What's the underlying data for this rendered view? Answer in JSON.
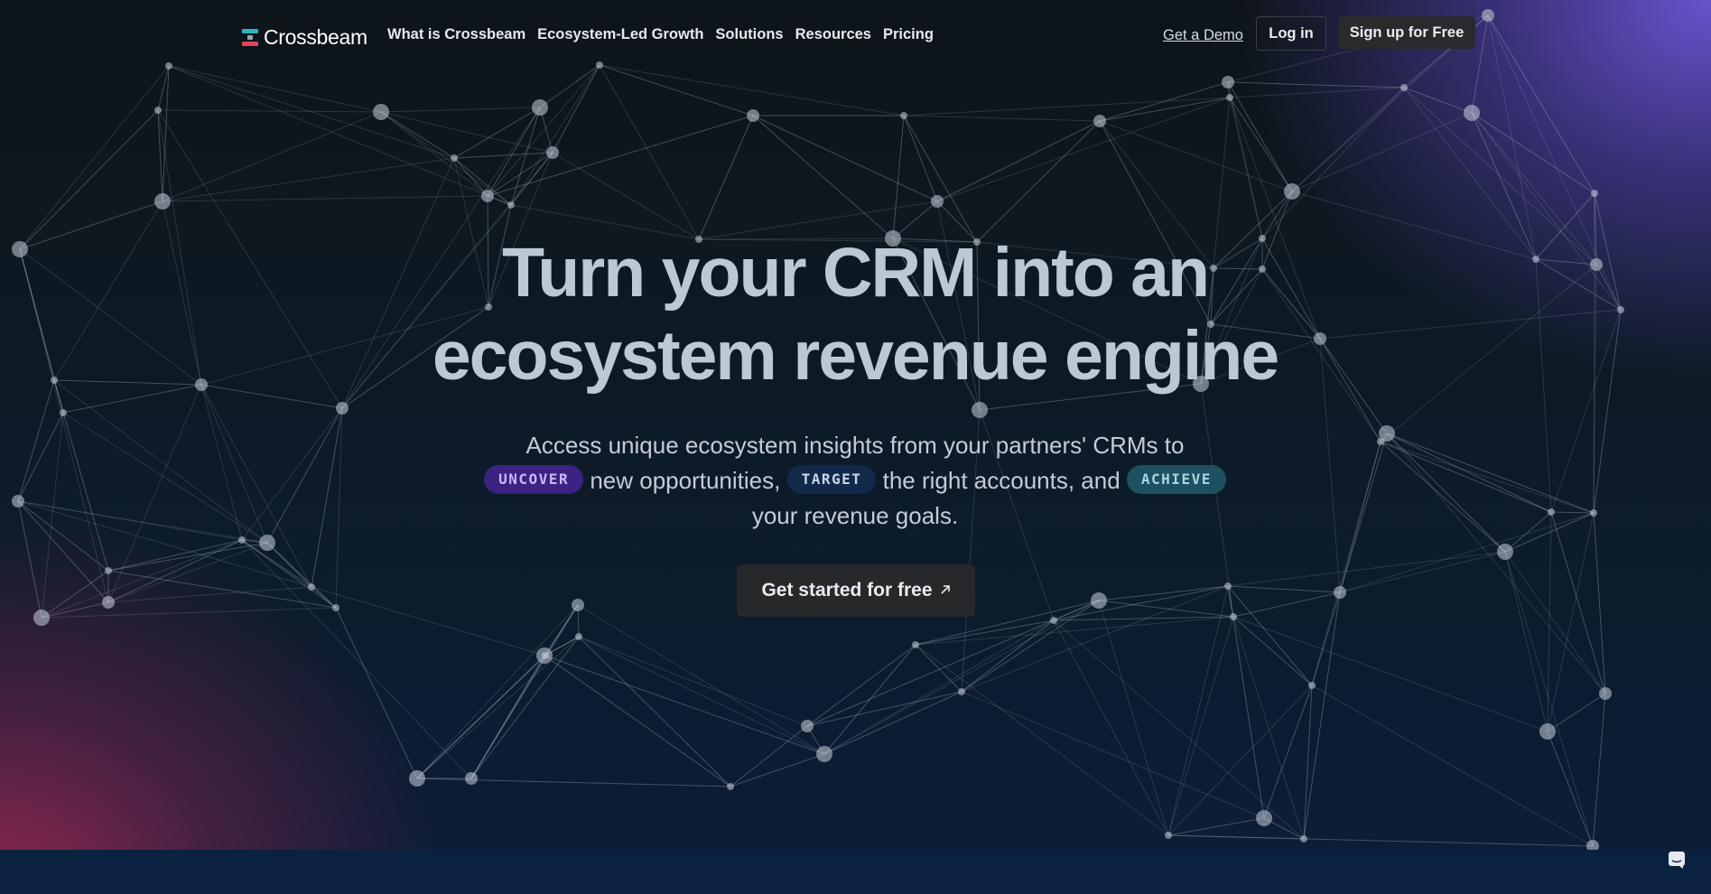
{
  "nav": {
    "logo_text": "Crossbeam",
    "links": [
      {
        "label": "What is Crossbeam"
      },
      {
        "label": "Ecosystem-Led Growth"
      },
      {
        "label": "Solutions"
      },
      {
        "label": "Resources"
      },
      {
        "label": "Pricing"
      }
    ],
    "demo_label": "Get a Demo",
    "login_label": "Log in",
    "signup_label": "Sign up for Free"
  },
  "hero": {
    "headline_line1": "Turn your CRM into an",
    "headline_line2": "ecosystem revenue engine",
    "sub_part1": "Access unique ecosystem insights from your partners' CRMs to",
    "pill_uncover": "UNCOVER",
    "sub_part2": "new opportunities,",
    "pill_target": "TARGET",
    "sub_part3": "the right accounts, and",
    "pill_achieve": "ACHIEVE",
    "sub_part4": "your revenue goals.",
    "cta_label": "Get started for free",
    "cta_icon": "arrow-up-right-icon"
  },
  "chat": {
    "icon": "chat-icon"
  },
  "colors": {
    "brand_teal": "#2bb3c0",
    "brand_red": "#e2445c",
    "pill_uncover": "#3b2283",
    "pill_target": "#11294a",
    "pill_achieve": "#1d5061"
  }
}
